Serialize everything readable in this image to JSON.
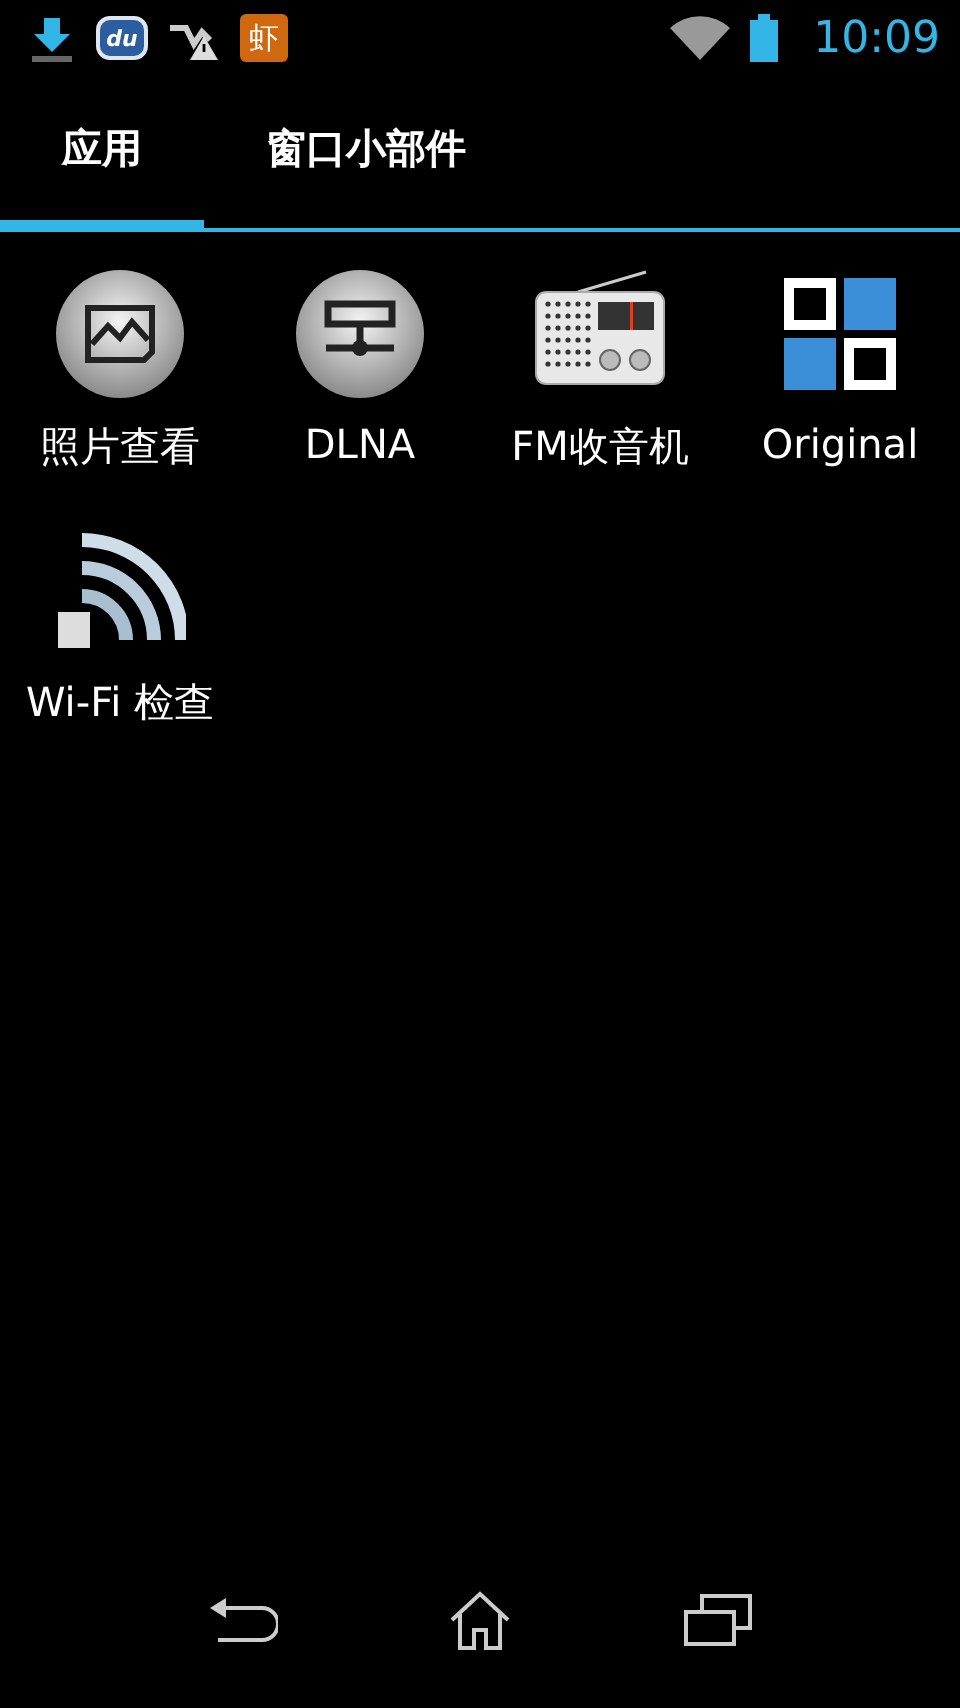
{
  "status_bar": {
    "notification_icons": [
      {
        "kind": "download"
      },
      {
        "kind": "badge",
        "text": "du"
      },
      {
        "kind": "signal-alert"
      },
      {
        "kind": "app",
        "text": "虾"
      }
    ],
    "time": "10:09"
  },
  "tabs": [
    {
      "label": "应用",
      "selected": true
    },
    {
      "label": "窗口小部件",
      "selected": false
    }
  ],
  "apps": [
    {
      "kind": "gallery",
      "label": "照片查看"
    },
    {
      "kind": "dlna",
      "label": "DLNA"
    },
    {
      "kind": "radio",
      "label": "FM收音机"
    },
    {
      "kind": "tiles",
      "label": "Original"
    },
    {
      "kind": "wifi",
      "label": "Wi-Fi 检查"
    }
  ]
}
